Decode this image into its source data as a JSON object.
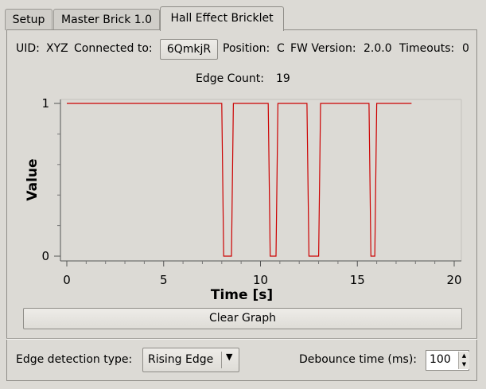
{
  "tabs": [
    {
      "label": "Setup",
      "active": false
    },
    {
      "label": "Master Brick 1.0",
      "active": false
    },
    {
      "label": "Hall Effect Bricklet",
      "active": true
    }
  ],
  "info": {
    "uid_label": "UID:",
    "uid_value": "XYZ",
    "connected_label": "Connected to:",
    "connected_value": "6QmkjR",
    "position_label": "Position:",
    "position_value": "C",
    "fw_label": "FW Version:",
    "fw_value": "2.0.0",
    "timeouts_label": "Timeouts:",
    "timeouts_value": "0"
  },
  "edge_count": {
    "label": "Edge Count:",
    "value": "19"
  },
  "chart_data": {
    "type": "line",
    "xlabel": "Time [s]",
    "ylabel": "Value",
    "xlim": [
      0,
      20
    ],
    "ylim": [
      0,
      1
    ],
    "xticks": [
      0,
      5,
      10,
      15,
      20
    ],
    "yticks": [
      0,
      1
    ],
    "grid": false,
    "series": [
      {
        "color": "#cc0000",
        "x": [
          0,
          8.0,
          8.1,
          8.5,
          8.6,
          10.4,
          10.5,
          10.8,
          10.9,
          12.4,
          12.5,
          13.0,
          13.1,
          15.6,
          15.7,
          15.9,
          16.0,
          17.8
        ],
        "y": [
          1,
          1,
          0,
          0,
          1,
          1,
          0,
          0,
          1,
          1,
          0,
          0,
          1,
          1,
          0,
          0,
          1,
          1
        ]
      }
    ]
  },
  "clear_graph_label": "Clear Graph",
  "edge_type": {
    "label": "Edge detection type:",
    "value": "Rising Edge"
  },
  "debounce": {
    "label": "Debounce time (ms):",
    "value": "100"
  },
  "icons": {
    "combo_arrow": "triangle-down",
    "spin_up": "triangle-up",
    "spin_down": "triangle-down"
  }
}
